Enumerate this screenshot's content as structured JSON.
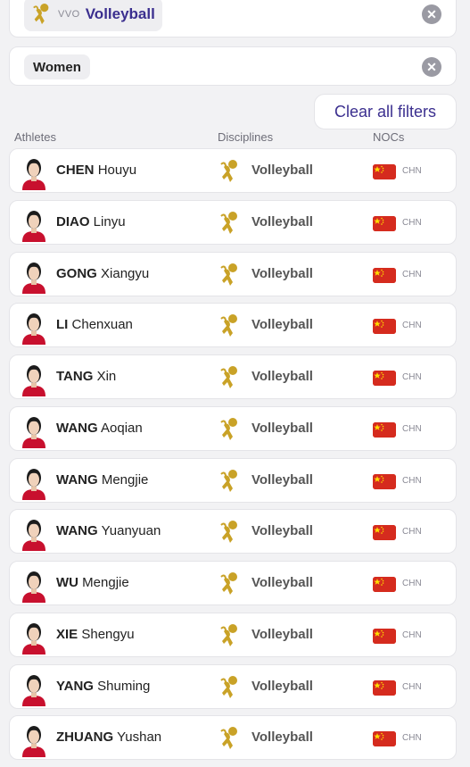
{
  "filters": {
    "discipline": {
      "code": "VVO",
      "label": "Volleyball"
    },
    "gender": {
      "label": "Women"
    },
    "clear_icon": "close-icon",
    "clear_all_label": "Clear all filters"
  },
  "columns": {
    "athletes": "Athletes",
    "disciplines": "Disciplines",
    "nocs": "NOCs"
  },
  "flag_color": "#d52b1e",
  "accent_color": "#3b2f8f",
  "athletes": [
    {
      "last": "CHEN",
      "first": "Houyu",
      "discipline": "Volleyball",
      "noc": "CHN"
    },
    {
      "last": "DIAO",
      "first": "Linyu",
      "discipline": "Volleyball",
      "noc": "CHN"
    },
    {
      "last": "GONG",
      "first": "Xiangyu",
      "discipline": "Volleyball",
      "noc": "CHN"
    },
    {
      "last": "LI",
      "first": "Chenxuan",
      "discipline": "Volleyball",
      "noc": "CHN"
    },
    {
      "last": "TANG",
      "first": "Xin",
      "discipline": "Volleyball",
      "noc": "CHN"
    },
    {
      "last": "WANG",
      "first": "Aoqian",
      "discipline": "Volleyball",
      "noc": "CHN"
    },
    {
      "last": "WANG",
      "first": "Mengjie",
      "discipline": "Volleyball",
      "noc": "CHN"
    },
    {
      "last": "WANG",
      "first": "Yuanyuan",
      "discipline": "Volleyball",
      "noc": "CHN"
    },
    {
      "last": "WU",
      "first": "Mengjie",
      "discipline": "Volleyball",
      "noc": "CHN"
    },
    {
      "last": "XIE",
      "first": "Shengyu",
      "discipline": "Volleyball",
      "noc": "CHN"
    },
    {
      "last": "YANG",
      "first": "Shuming",
      "discipline": "Volleyball",
      "noc": "CHN"
    },
    {
      "last": "ZHUANG",
      "first": "Yushan",
      "discipline": "Volleyball",
      "noc": "CHN"
    }
  ]
}
